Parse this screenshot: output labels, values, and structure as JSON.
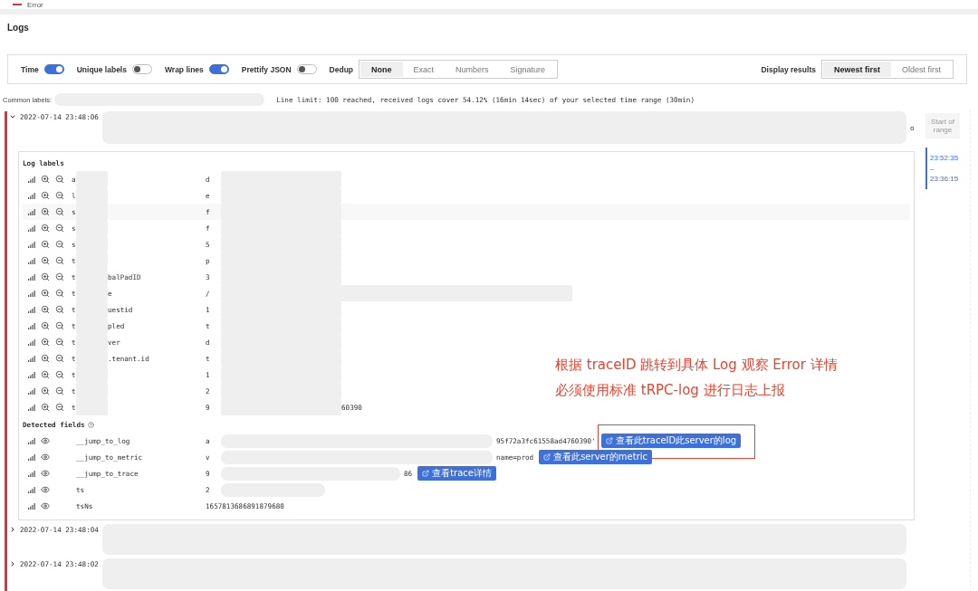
{
  "legend": {
    "label": "Error"
  },
  "title": "Logs",
  "options": {
    "toggles": [
      {
        "label": "Time",
        "on": true
      },
      {
        "label": "Unique labels",
        "on": false
      },
      {
        "label": "Wrap lines",
        "on": true
      },
      {
        "label": "Prettify JSON",
        "on": false
      }
    ],
    "dedup": {
      "label": "Dedup",
      "choices": [
        {
          "label": "None",
          "selected": true
        },
        {
          "label": "Exact",
          "selected": false
        },
        {
          "label": "Numbers",
          "selected": false
        },
        {
          "label": "Signature",
          "selected": false
        }
      ]
    },
    "display": {
      "label": "Display results",
      "choices": [
        {
          "label": "Newest first",
          "selected": true
        },
        {
          "label": "Oldest first",
          "selected": false
        }
      ]
    }
  },
  "common_labels": {
    "label": "Common labels:"
  },
  "line_limit": "Line limit: 100 reached, received logs cover 54.12% (16min 14sec) of your selected time range (30min)",
  "logs": [
    {
      "time": "2022-07-14 23:48:06",
      "expanded": true,
      "tail": "o",
      "details": {
        "labels_title": "Log labels",
        "labels": [
          {
            "key": "a",
            "value": "d"
          },
          {
            "key": "l",
            "value": "e"
          },
          {
            "key": "s",
            "value": "f"
          },
          {
            "key": "s",
            "value": "f"
          },
          {
            "key": "s",
            "value": "5"
          },
          {
            "key": "t",
            "value": "p"
          },
          {
            "key": "t",
            "key_tail": "balPadID",
            "value": "3"
          },
          {
            "key": "t",
            "key_tail": "e",
            "value": "/"
          },
          {
            "key": "t",
            "key_tail": "uestid",
            "value": "1"
          },
          {
            "key": "t",
            "key_tail": "pled",
            "value": "t"
          },
          {
            "key": "t",
            "key_tail": "ver",
            "value": "d"
          },
          {
            "key": "t",
            "key_tail": ".tenant.id",
            "value": "t"
          },
          {
            "key": "t",
            "value": "1"
          },
          {
            "key": "t",
            "value": "2"
          },
          {
            "key": "t",
            "value": "9",
            "value_tail": "60390"
          }
        ],
        "fields_title": "Detected fields",
        "fields": [
          {
            "key": "__jump_to_log",
            "value": "a",
            "value_tail": "95f72a3fc61558ad4760390'",
            "link": "查看此traceID此server的log"
          },
          {
            "key": "__jump_to_metric",
            "value": "v",
            "value_tail": "name=prod",
            "link": "查看此server的metric"
          },
          {
            "key": "__jump_to_trace",
            "value": "9",
            "value_tail": "86",
            "link": "查看trace详情"
          },
          {
            "key": "ts",
            "value": "2"
          },
          {
            "key": "tsNs",
            "value": "1657813686891879680"
          }
        ]
      }
    },
    {
      "time": "2022-07-14 23:48:04",
      "expanded": false
    },
    {
      "time": "2022-07-14 23:48:02",
      "expanded": false
    }
  ],
  "annotation": {
    "lines": [
      "根据 traceID 跳转到具体 Log 观察 Error 详情",
      "必须使用标准 tRPC-log 进行日志上报"
    ]
  },
  "range": {
    "start_label": "Start of range",
    "from": "23:52:35",
    "sep": "–",
    "to": "23:36:15"
  }
}
